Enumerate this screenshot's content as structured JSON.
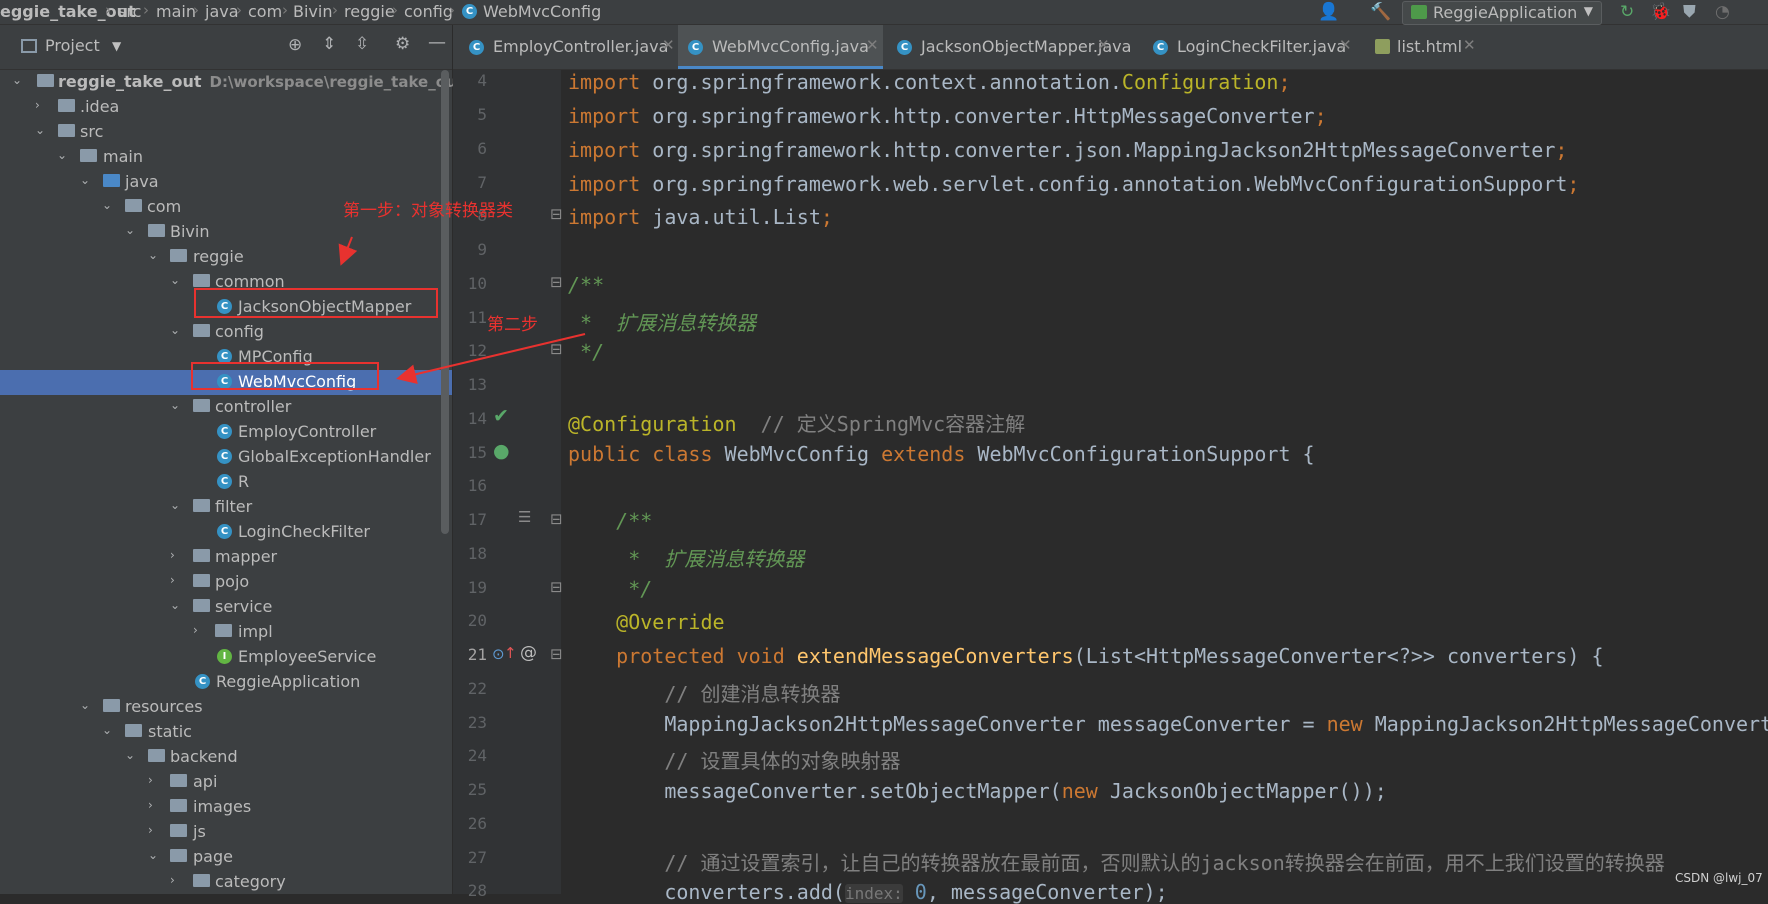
{
  "breadcrumb": [
    "eggie_take_out",
    "src",
    "main",
    "java",
    "com",
    "Bivin",
    "reggie",
    "config",
    "WebMvcConfig"
  ],
  "run_config": {
    "label": "ReggieApplication"
  },
  "project_panel": {
    "title": "Project"
  },
  "tree": [
    {
      "label": "reggie_take_out",
      "path": "D:\\workspace\\reggie_take_out",
      "kind": "module"
    },
    {
      "label": ".idea",
      "kind": "folder"
    },
    {
      "label": "src",
      "kind": "folder"
    },
    {
      "label": "main",
      "kind": "folder"
    },
    {
      "label": "java",
      "kind": "srcfolder"
    },
    {
      "label": "com",
      "kind": "package"
    },
    {
      "label": "Bivin",
      "kind": "package"
    },
    {
      "label": "reggie",
      "kind": "package"
    },
    {
      "label": "common",
      "kind": "package"
    },
    {
      "label": "JacksonObjectMapper",
      "kind": "class"
    },
    {
      "label": "config",
      "kind": "package"
    },
    {
      "label": "MPConfig",
      "kind": "class"
    },
    {
      "label": "WebMvcConfig",
      "kind": "class"
    },
    {
      "label": "controller",
      "kind": "package"
    },
    {
      "label": "EmployController",
      "kind": "class"
    },
    {
      "label": "GlobalExceptionHandler",
      "kind": "class"
    },
    {
      "label": "R",
      "kind": "class"
    },
    {
      "label": "filter",
      "kind": "package"
    },
    {
      "label": "LoginCheckFilter",
      "kind": "class"
    },
    {
      "label": "mapper",
      "kind": "package"
    },
    {
      "label": "pojo",
      "kind": "package"
    },
    {
      "label": "service",
      "kind": "package"
    },
    {
      "label": "impl",
      "kind": "package"
    },
    {
      "label": "EmployeeService",
      "kind": "interface"
    },
    {
      "label": "ReggieApplication",
      "kind": "app"
    },
    {
      "label": "resources",
      "kind": "folder"
    },
    {
      "label": "static",
      "kind": "folder"
    },
    {
      "label": "backend",
      "kind": "folder"
    },
    {
      "label": "api",
      "kind": "folder"
    },
    {
      "label": "images",
      "kind": "folder"
    },
    {
      "label": "js",
      "kind": "folder"
    },
    {
      "label": "page",
      "kind": "folder"
    },
    {
      "label": "category",
      "kind": "folder"
    }
  ],
  "tabs": [
    {
      "label": "EmployController.java"
    },
    {
      "label": "WebMvcConfig.java"
    },
    {
      "label": "JacksonObjectMapper.java"
    },
    {
      "label": "LoginCheckFilter.java"
    },
    {
      "label": "list.html"
    }
  ],
  "line_numbers": [
    "4",
    "5",
    "6",
    "7",
    "8",
    "9",
    "10",
    "11",
    "12",
    "13",
    "14",
    "15",
    "16",
    "17",
    "18",
    "19",
    "20",
    "21",
    "22",
    "23",
    "24",
    "25",
    "26",
    "27",
    "28"
  ],
  "code": {
    "l4_a": "import ",
    "l4_b": "org.springframework.context.annotation.",
    "l4_c": "Configuration",
    "l4_d": ";",
    "l5_a": "import ",
    "l5_b": "org.springframework.http.converter.HttpMessageConverter",
    "l5_c": ";",
    "l6_a": "import ",
    "l6_b": "org.springframework.http.converter.json.MappingJackson2HttpMessageConverter",
    "l6_c": ";",
    "l7_a": "import ",
    "l7_b": "org.springframework.web.servlet.config.annotation.WebMvcConfigurationSupport",
    "l7_c": ";",
    "l8_a": "import ",
    "l8_b": "java.util.List",
    "l8_c": ";",
    "l10": "/**",
    "l11": " *  扩展消息转换器",
    "l12": " */",
    "l14_a": "@Configuration",
    "l14_b": "  // 定义SpringMvc容器注解",
    "l15_a": "public class ",
    "l15_b": "WebMvcConfig ",
    "l15_c": "extends ",
    "l15_d": "WebMvcConfigurationSupport {",
    "l17": "    /**",
    "l18": "     *  扩展消息转换器",
    "l19": "     */",
    "l20": "    @Override",
    "l21_a": "    protected void ",
    "l21_b": "extendMessageConverters",
    "l21_c": "(List<HttpMessageConverter<?>> converters) {",
    "l22": "        // 创建消息转换器",
    "l23_a": "        MappingJackson2HttpMessageConverter messageConverter = ",
    "l23_b": "new ",
    "l23_c": "MappingJackson2HttpMessageConvert",
    "l24": "        // 设置具体的对象映射器",
    "l25_a": "        messageConverter.setObjectMapper(",
    "l25_b": "new ",
    "l25_c": "JacksonObjectMapper());",
    "l27": "        // 通过设置索引，让自己的转换器放在最前面，否则默认的jackson转换器会在前面，用不上我们设置的转换器",
    "l28_a": "        converters.add(",
    "l28_hint": "index:",
    "l28_b": " 0",
    "l28_c": ", messageConverter);"
  },
  "annotations": {
    "step1": "第一步：对象转换器类",
    "step2": "第二步"
  },
  "watermark": "CSDN @lwj_07",
  "colors": {
    "accent_red": "#e8322f",
    "selection": "#4b6eaf"
  }
}
